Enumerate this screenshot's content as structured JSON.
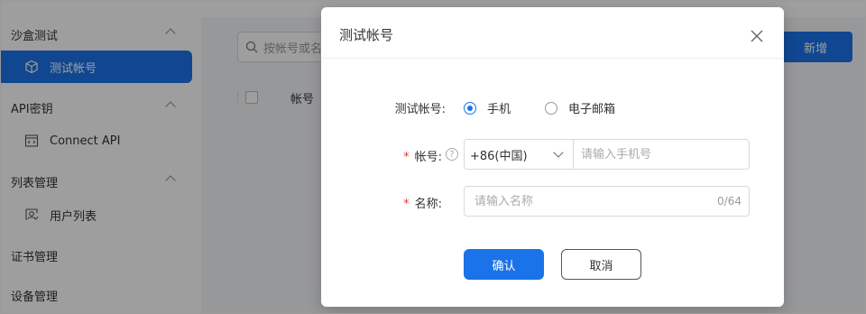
{
  "sidebar": {
    "groups": [
      {
        "label": "沙盒测试"
      },
      {
        "label": "API密钥"
      },
      {
        "label": "列表管理"
      },
      {
        "label": "证书管理"
      },
      {
        "label": "设备管理"
      }
    ],
    "items": [
      {
        "label": "测试帐号",
        "icon": "cube-icon",
        "active": true
      },
      {
        "label": "Connect API",
        "icon": "code-window-icon"
      },
      {
        "label": "用户列表",
        "icon": "user-list-icon"
      }
    ]
  },
  "main": {
    "search_placeholder": "按帐号或名",
    "new_button": "新增",
    "table_header": "帐号"
  },
  "modal": {
    "title": "测试帐号",
    "account_type_label": "测试帐号:",
    "options": [
      "手机",
      "电子邮箱"
    ],
    "selected_option": "手机",
    "account_label": "帐号:",
    "country_code": "+86(中国)",
    "phone_placeholder": "请输入手机号",
    "name_label": "名称:",
    "name_placeholder": "请输入名称",
    "name_counter": "0/64",
    "confirm": "确认",
    "cancel": "取消",
    "required_mark": "*",
    "help_mark": "?"
  },
  "colors": {
    "primary": "#1a73e8",
    "required": "#e53935"
  }
}
